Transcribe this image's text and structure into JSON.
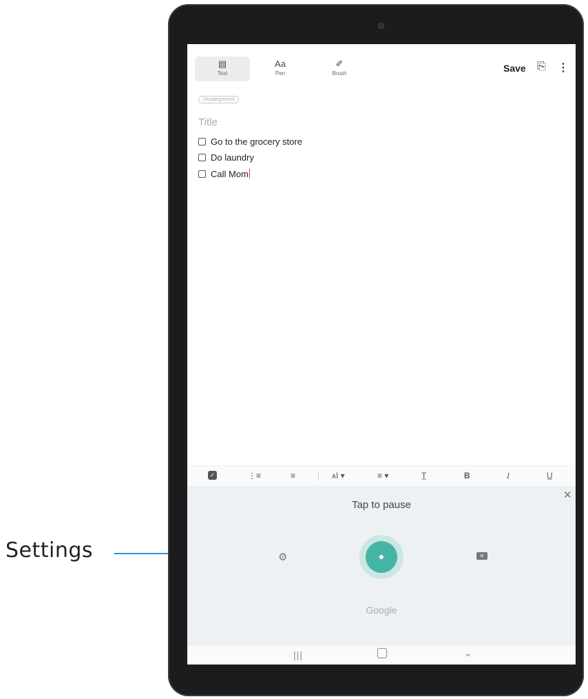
{
  "callout": {
    "label": "Settings"
  },
  "toolbar": {
    "modes": [
      {
        "label": "Text",
        "icon": "keyboard-icon"
      },
      {
        "label": "Pen",
        "icon": "pen-icon"
      },
      {
        "label": "Brush",
        "icon": "brush-icon"
      }
    ],
    "mode_glyphs": [
      "▤",
      "Aa",
      "✐"
    ],
    "save_label": "Save",
    "attach_icon": "paperclip-icon",
    "more_icon": "more-vertical-icon"
  },
  "note": {
    "category": "Uncategorized",
    "title_placeholder": "Title",
    "items": [
      {
        "text": "Go to the grocery store",
        "checked": false
      },
      {
        "text": "Do laundry",
        "checked": false
      },
      {
        "text": "Call Mom",
        "checked": false
      }
    ]
  },
  "format_bar": {
    "tools": [
      "checkbox-icon",
      "numbered-list-icon",
      "bulleted-list-icon",
      "font-size-icon",
      "align-icon",
      "text-color-icon",
      "bold-icon",
      "italic-icon",
      "underline-icon"
    ],
    "glyphs": [
      "✓",
      "⋮≡",
      "≡",
      "ᴀI ▾",
      "≡ ▾",
      "T̲",
      "B",
      "I",
      "U̲"
    ]
  },
  "voice": {
    "status": "Tap to pause",
    "brand": "Google",
    "accent_color": "#45b5a5"
  },
  "nav": {
    "icons": [
      "recents-icon",
      "home-icon",
      "back-icon"
    ]
  }
}
